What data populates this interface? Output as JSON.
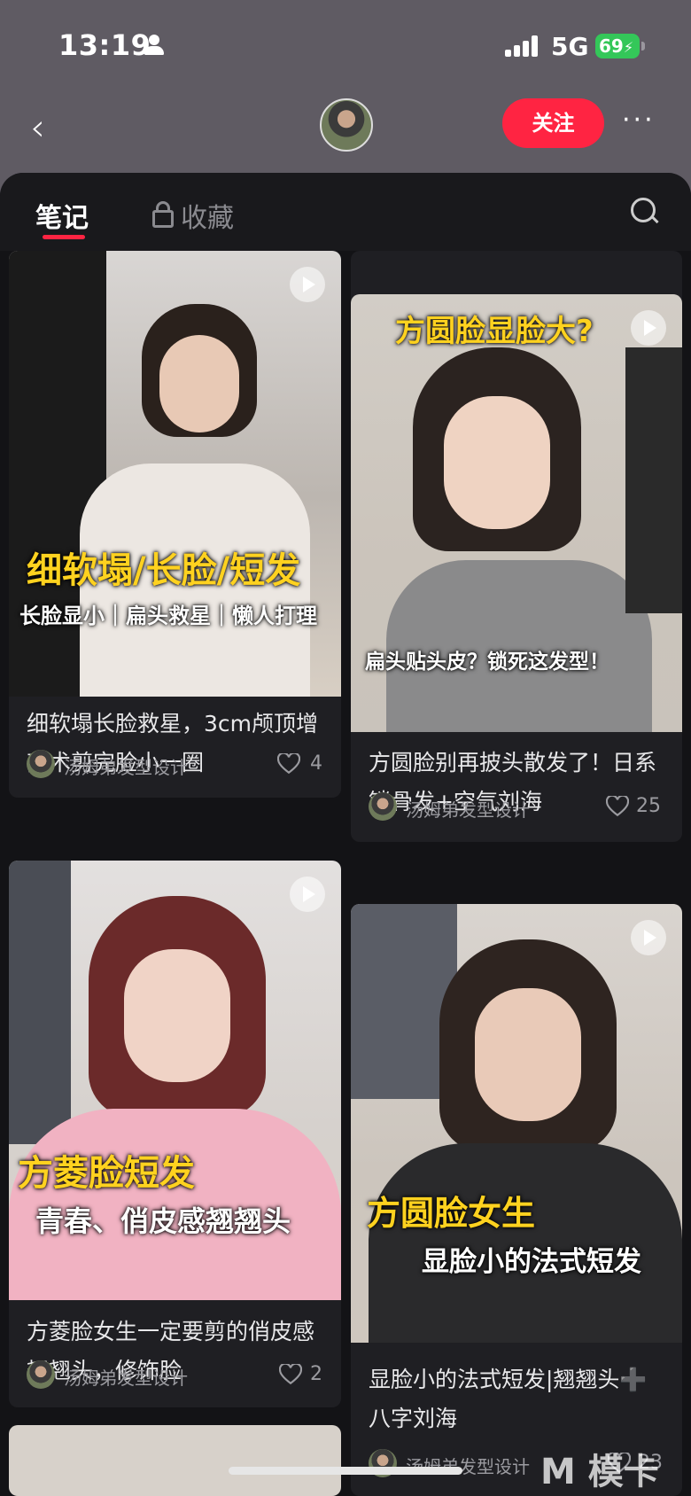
{
  "status_bar": {
    "time": "13:19",
    "network": "5G",
    "battery": "69"
  },
  "nav": {
    "follow_label": "关注",
    "more_label": "···",
    "back_label": "‹"
  },
  "tabs": {
    "notes": "笔记",
    "collections": "收藏"
  },
  "author_name": "汤姆弟发型设计",
  "cards": [
    {
      "title": "",
      "caption_y": "",
      "caption_w": "",
      "likes": "2"
    },
    {
      "title": "细软塌长脸救星，3cm颅顶增高术剪完脸小一圈",
      "caption_y": "细软塌/长脸/短发",
      "caption_w": "长脸显小｜扁头救星｜懒人打理",
      "likes": "4"
    },
    {
      "title": "方圆脸别再披头散发了！日系锁骨发+空气刘海",
      "caption_y": "方圆脸显脸大?",
      "caption_w": "扁头贴头皮？锁死这发型！",
      "likes": "25"
    },
    {
      "title": "方菱脸女生一定要剪的俏皮感翘翘头，修饰脸",
      "caption_y": "方菱脸短发",
      "caption_w": "青春、俏皮感翘翘头",
      "likes": "2"
    },
    {
      "title": "显脸小的法式短发|翘翘头➕八字刘海",
      "caption_y": "方圆脸女生",
      "caption_w": "显脸小的法式短发",
      "likes": "23"
    }
  ],
  "watermark": "M 模卡",
  "colors": {
    "accent": "#ff2442",
    "caption_yellow": "#ffd21f",
    "background": "#131316"
  }
}
